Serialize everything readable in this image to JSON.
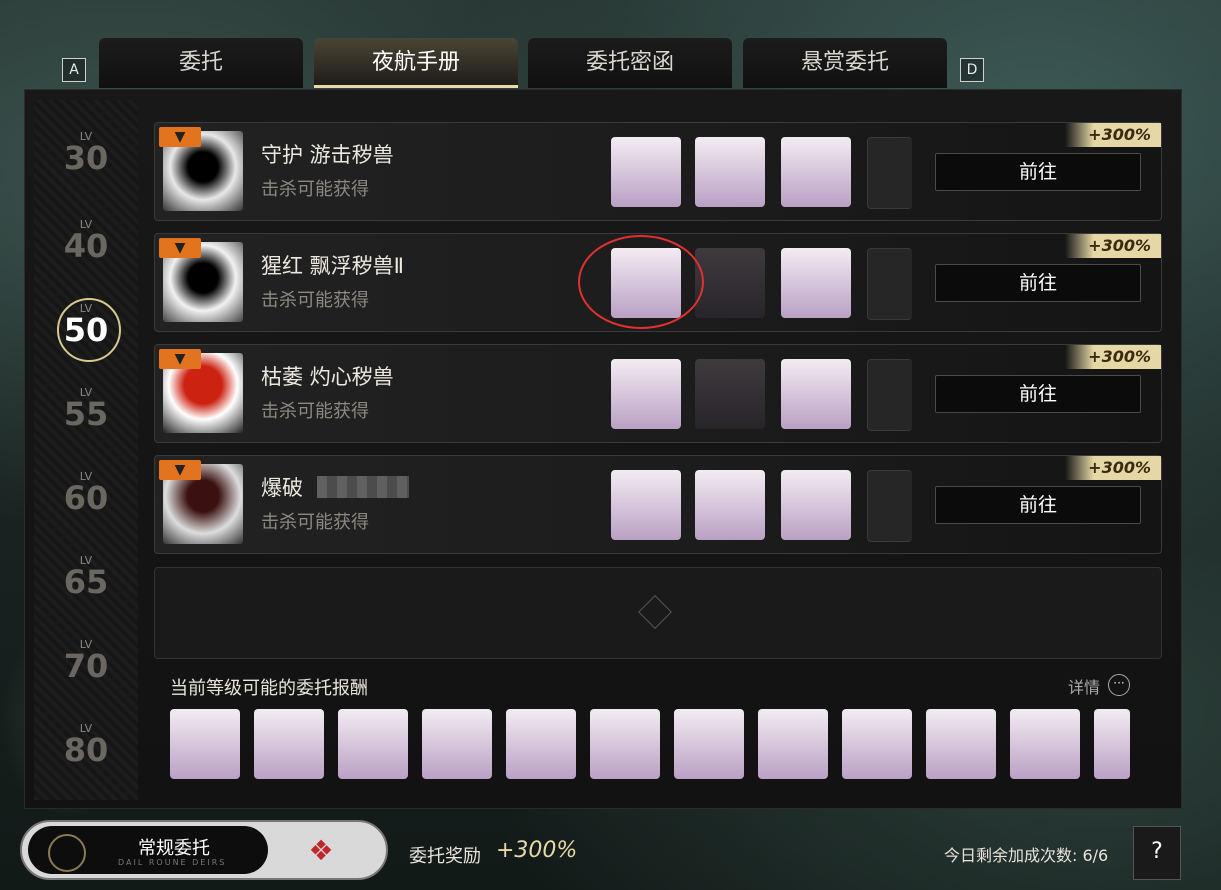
{
  "keys": {
    "left": "A",
    "right": "D"
  },
  "tabs": [
    {
      "label": "委托"
    },
    {
      "label": "夜航手册"
    },
    {
      "label": "委托密函"
    },
    {
      "label": "悬赏委托"
    }
  ],
  "levels": [
    {
      "lab": "LV",
      "num": "30"
    },
    {
      "lab": "LV",
      "num": "40"
    },
    {
      "lab": "LV",
      "num": "50"
    },
    {
      "lab": "LV",
      "num": "55"
    },
    {
      "lab": "LV",
      "num": "60"
    },
    {
      "lab": "LV",
      "num": "65"
    },
    {
      "lab": "LV",
      "num": "70"
    },
    {
      "lab": "LV",
      "num": "80"
    }
  ],
  "missions": [
    {
      "name": "守护 游击秽兽",
      "sub": "击杀可能获得",
      "bonus": "+300%",
      "go": "前往"
    },
    {
      "name": "猩红 飘浮秽兽Ⅱ",
      "sub": "击杀可能获得",
      "bonus": "+300%",
      "go": "前往"
    },
    {
      "name": "枯萎 灼心秽兽",
      "sub": "击杀可能获得",
      "bonus": "+300%",
      "go": "前往"
    },
    {
      "name": "爆破",
      "sub": "击杀可能获得",
      "bonus": "+300%",
      "go": "前往"
    }
  ],
  "rewards": {
    "title": "当前等级可能的委托报酬",
    "detail": "详情",
    "detail_icon": "···"
  },
  "bottom": {
    "toggle_label": "常规委托",
    "toggle_sub": "DAIL ROUNE DEIRS",
    "reward_label": "委托奖励",
    "reward_value": "+300%",
    "remaining": "今日剩余加成次数: 6/6",
    "help": "?"
  }
}
